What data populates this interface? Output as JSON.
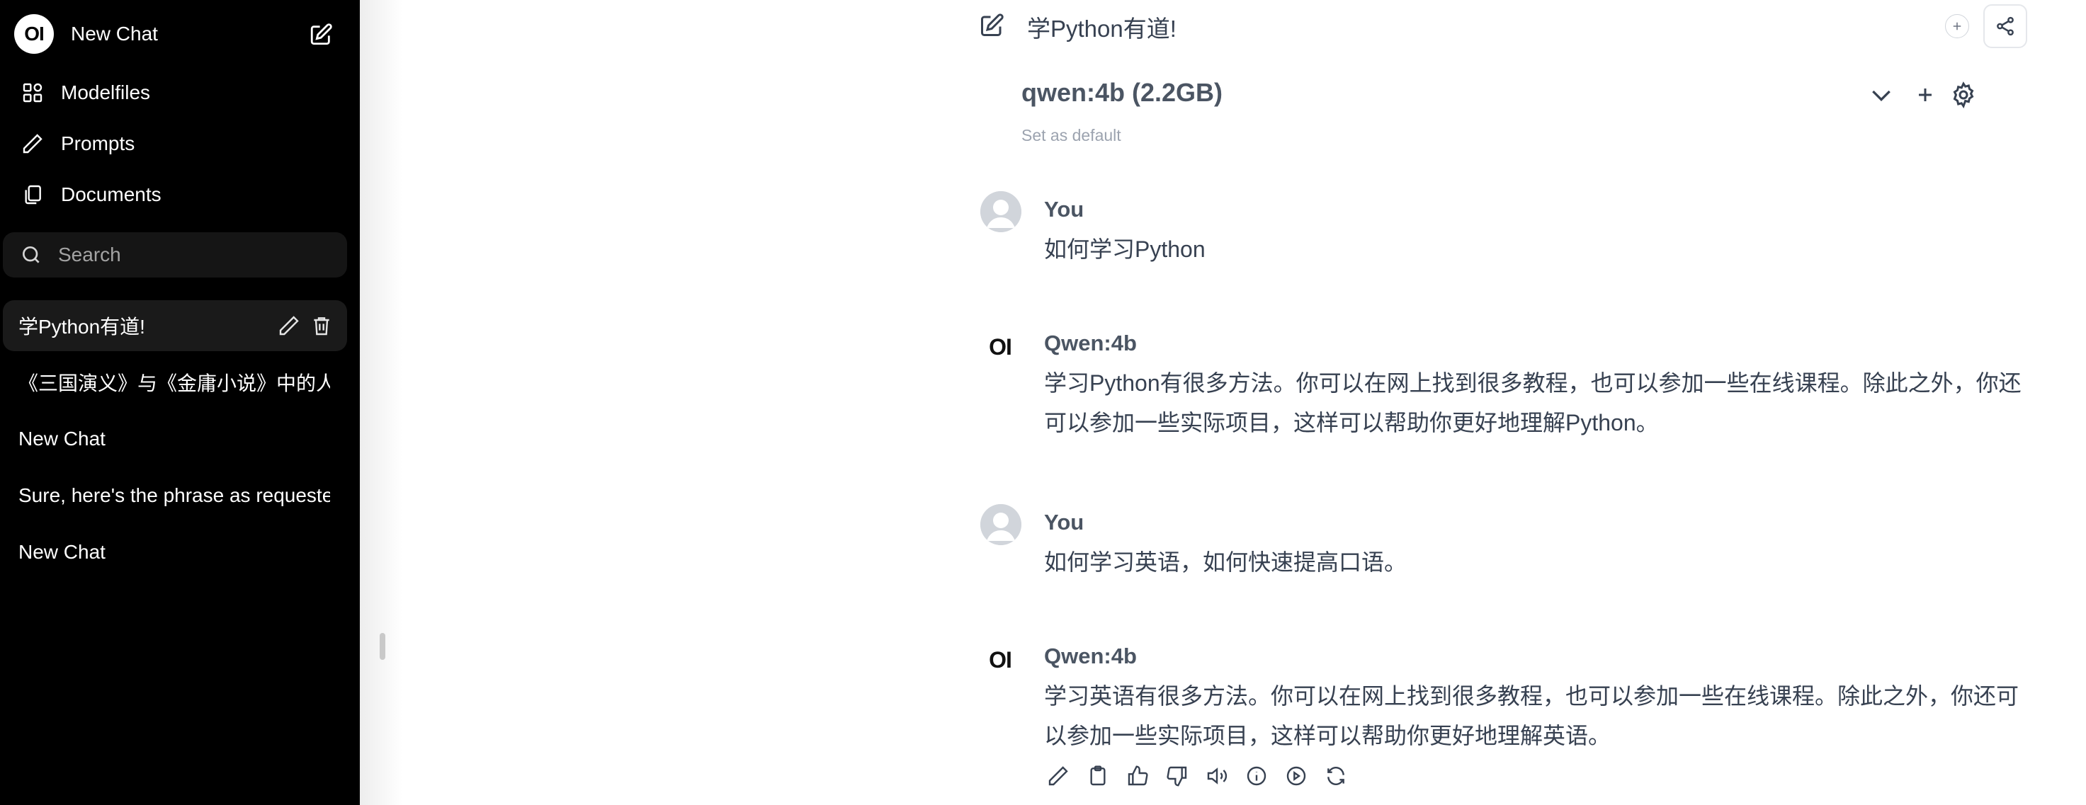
{
  "sidebar": {
    "logo_text": "OI",
    "new_chat_label": "New Chat",
    "nav": [
      {
        "label": "Modelfiles",
        "icon": "modelfiles-icon"
      },
      {
        "label": "Prompts",
        "icon": "pencil-icon"
      },
      {
        "label": "Documents",
        "icon": "documents-icon"
      }
    ],
    "search_placeholder": "Search",
    "chats": [
      {
        "title": "学Python有道!",
        "active": true
      },
      {
        "title": "《三国演义》与《金庸小说》中的人物",
        "active": false
      },
      {
        "title": "New Chat",
        "active": false
      },
      {
        "title": "Sure, here's the phrase as requested",
        "active": false
      },
      {
        "title": "New Chat",
        "active": false
      }
    ]
  },
  "header": {
    "chat_title": "学Python有道!"
  },
  "model": {
    "name": "qwen:4b (2.2GB)",
    "set_default": "Set as default"
  },
  "messages": [
    {
      "role": "user",
      "name": "You",
      "text": "如何学习Python"
    },
    {
      "role": "assistant",
      "name": "Qwen:4b",
      "avatar_text": "OI",
      "text": "学习Python有很多方法。你可以在网上找到很多教程，也可以参加一些在线课程。除此之外，你还可以参加一些实际项目，这样可以帮助你更好地理解Python。"
    },
    {
      "role": "user",
      "name": "You",
      "text": "如何学习英语，如何快速提高口语。"
    },
    {
      "role": "assistant",
      "name": "Qwen:4b",
      "avatar_text": "OI",
      "text": "学习英语有很多方法。你可以在网上找到很多教程，也可以参加一些在线课程。除此之外，你还可以参加一些实际项目，这样可以帮助你更好地理解英语。"
    }
  ],
  "message_actions": [
    "edit-icon",
    "copy-icon",
    "thumbs-up-icon",
    "thumbs-down-icon",
    "speaker-icon",
    "info-icon",
    "play-icon",
    "regenerate-icon"
  ],
  "colors": {
    "sidebar_bg": "#000000",
    "active_chat_bg": "#1a1a1a",
    "text": "#374151"
  }
}
